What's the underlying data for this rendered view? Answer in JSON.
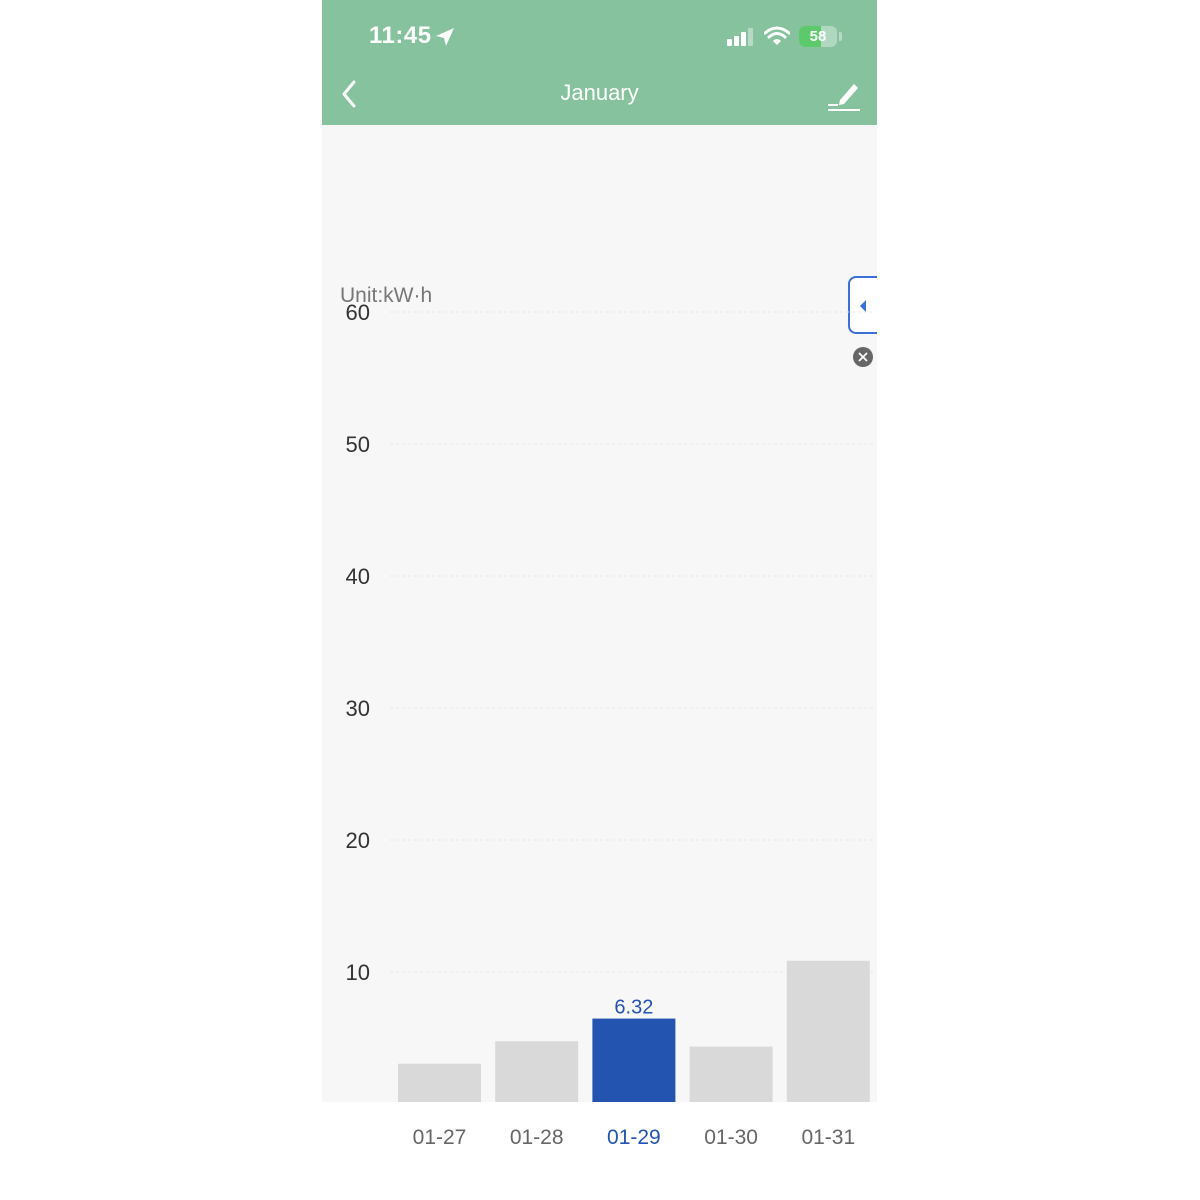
{
  "status_bar": {
    "time": "11:45",
    "battery": "58",
    "battery_level": 0.58
  },
  "nav": {
    "title": "January"
  },
  "icons": [
    "location-arrow-icon",
    "signal-icon",
    "wifi-icon",
    "battery-icon",
    "chevron-left-icon",
    "edit-pencil-icon",
    "caret-left-icon",
    "close-icon"
  ],
  "colors": {
    "header": "#86c29e",
    "selected_bar": "#2254b0",
    "bar": "#d9d9d9",
    "selected_label": "#2254b0"
  },
  "chart_data": {
    "type": "bar",
    "unit_label": "Unit:kW·h",
    "categories": [
      "01-27",
      "01-28",
      "01-29",
      "01-30",
      "01-31"
    ],
    "values": [
      2.9,
      4.6,
      6.32,
      4.2,
      10.7
    ],
    "selected_index": 2,
    "selected_label": "6.32",
    "yticks": [
      10,
      20,
      30,
      40,
      50,
      60
    ],
    "ylim": [
      0,
      62
    ],
    "grid": true
  }
}
